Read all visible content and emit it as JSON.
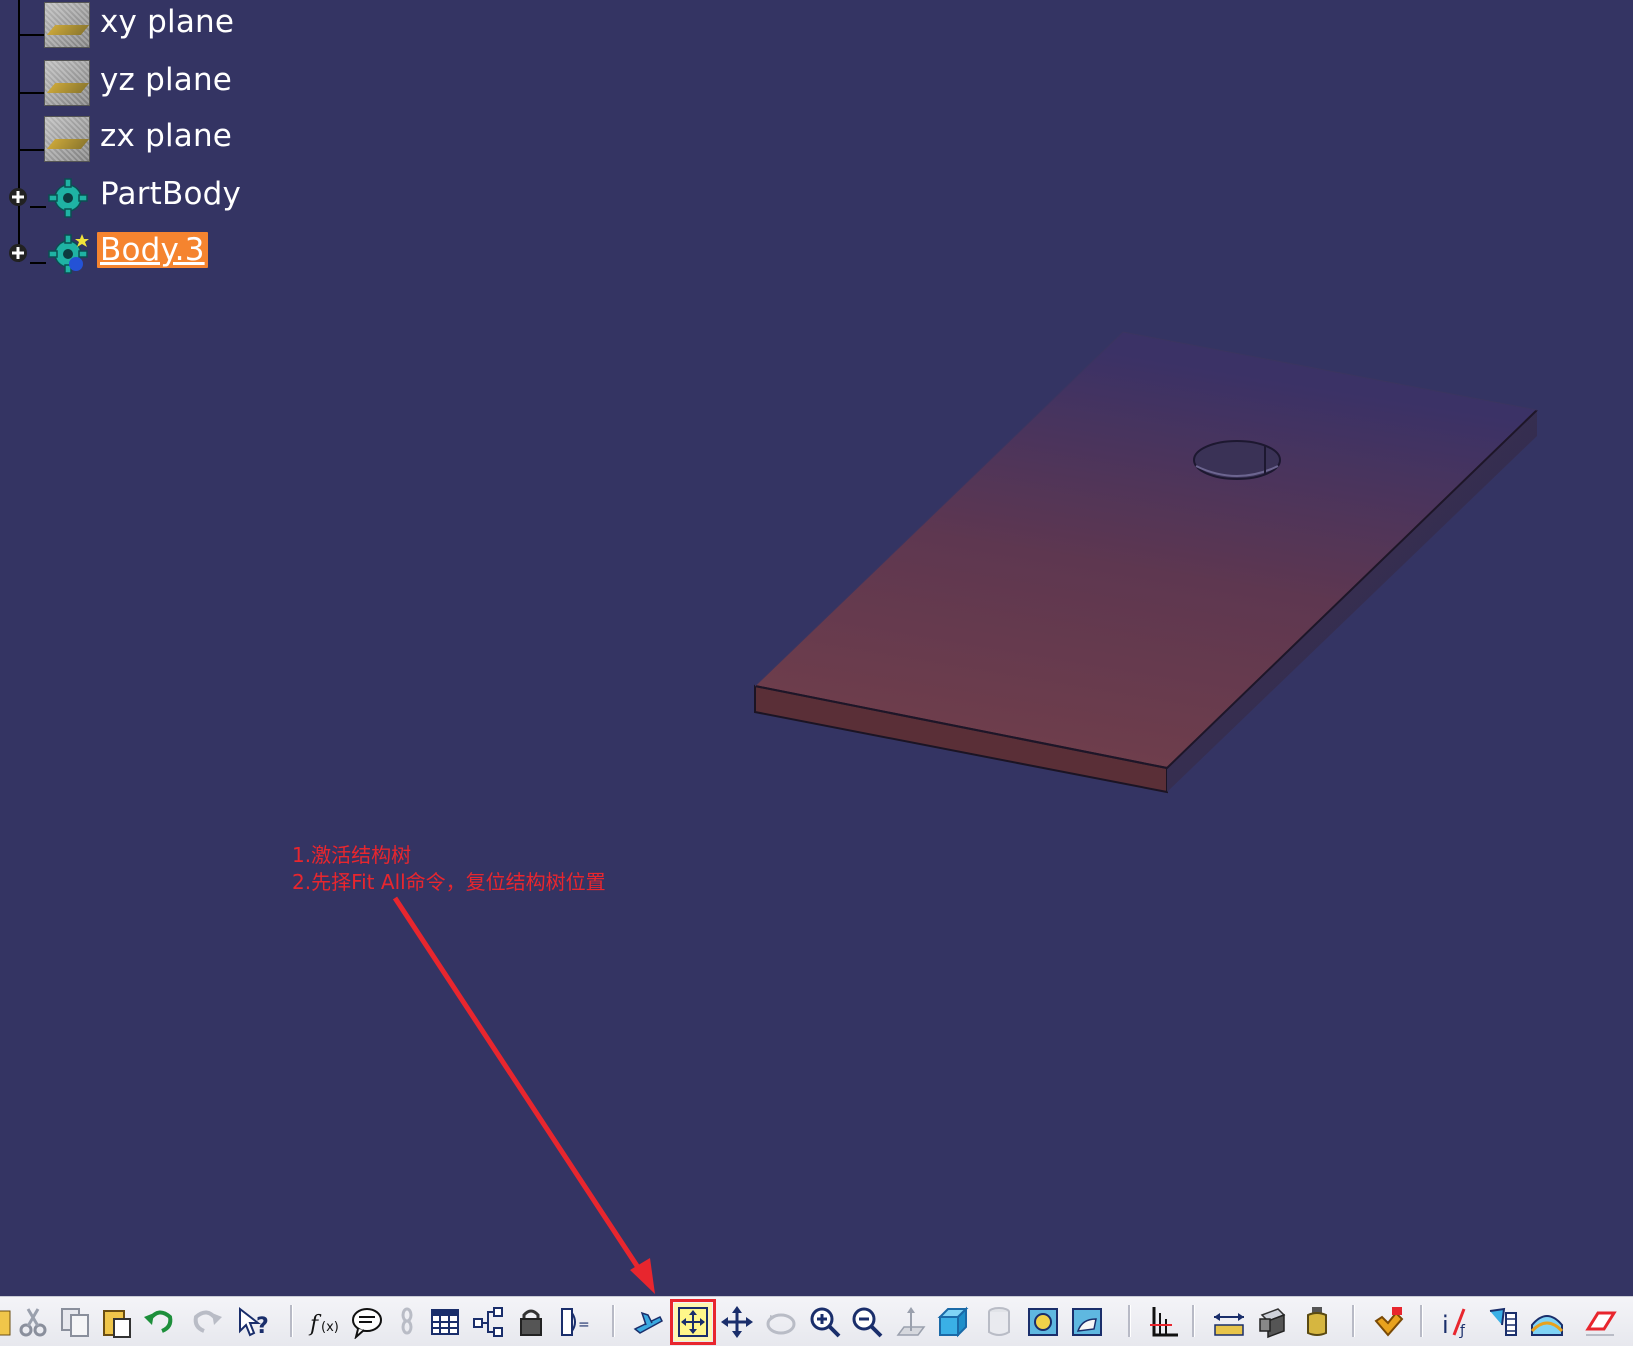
{
  "tree": {
    "nodes": [
      {
        "label": "xy plane",
        "icon": "plane-icon"
      },
      {
        "label": "yz plane",
        "icon": "plane-icon"
      },
      {
        "label": "zx plane",
        "icon": "plane-icon"
      },
      {
        "label": "PartBody",
        "icon": "body-gear-icon"
      },
      {
        "label": "Body.3",
        "icon": "body-gear-active-icon",
        "selected": true
      }
    ]
  },
  "annotation": {
    "line1": "1.激活结构树",
    "line2": "2.先择Fit All命令，复位结构树位置"
  },
  "toolbar": {
    "highlighted": "fit-all-button",
    "buttons": [
      "paste-icon-partial",
      "cut-icon",
      "copy-icon",
      "paste-icon",
      "undo-icon",
      "redo-icon",
      "help-icon",
      "formula-icon",
      "comment-icon",
      "link-icon",
      "table-icon",
      "tree-icon",
      "lock-icon",
      "equation-icon",
      "fly-mode-icon",
      "fit-all-icon",
      "pan-icon",
      "rotate-icon",
      "zoom-in-icon",
      "zoom-out-icon",
      "normal-view-icon",
      "iso-view-icon",
      "hide-show-icon",
      "swap-visible-icon",
      "render-icon",
      "axis-system-icon",
      "measure-between-icon",
      "measure-item-icon",
      "measure-inertia-icon",
      "apply-material-icon",
      "knowledge-icon",
      "catalog-icon",
      "analysis-icon",
      "sketch-analysis-icon"
    ]
  },
  "colors": {
    "background": "#343463",
    "selection": "#f5842f",
    "annotation": "#e8262e",
    "part_top": "#6b3a48",
    "part_side": "#5a2f37"
  }
}
